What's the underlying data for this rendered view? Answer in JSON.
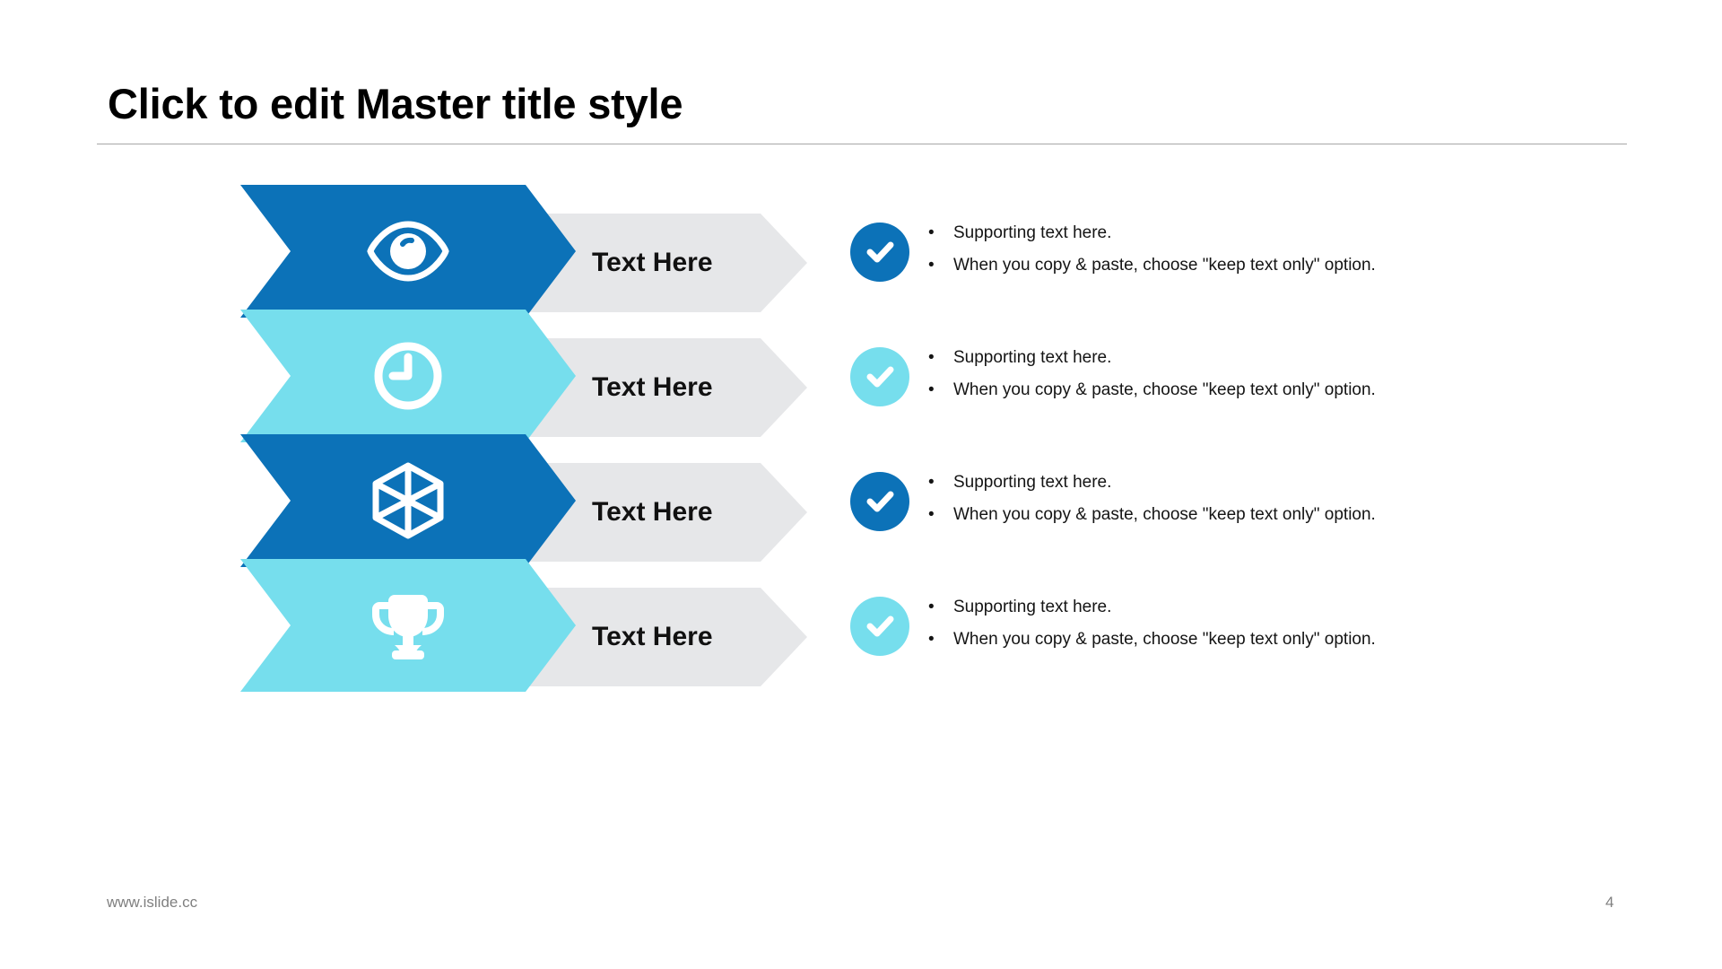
{
  "slide": {
    "title": "Click to edit Master title style",
    "footer_url": "www.islide.cc",
    "page_number": "4"
  },
  "colors": {
    "dark_blue": "#0C72B8",
    "light_blue": "#76DEED",
    "gray_chevron": "#E6E7E9",
    "title_rule": "#A6A6A6",
    "text": "#141414",
    "footer": "#7F7F7F"
  },
  "rows": [
    {
      "icon": "eye-icon",
      "color": "#0C72B8",
      "label": "Text Here",
      "badge": "check-circle-icon",
      "badge_color": "#0C72B8",
      "bullets": [
        "Supporting  text here.",
        "When  you copy & paste, choose \"keep text only\" option."
      ]
    },
    {
      "icon": "clock-icon",
      "color": "#76DEED",
      "label": "Text Here",
      "badge": "check-circle-icon",
      "badge_color": "#76DEED",
      "bullets": [
        "Supporting  text here.",
        "When  you copy & paste, choose \"keep text only\" option."
      ]
    },
    {
      "icon": "cube-icon",
      "color": "#0C72B8",
      "label": "Text Here",
      "badge": "check-circle-icon",
      "badge_color": "#0C72B8",
      "bullets": [
        "Supporting  text here.",
        "When  you copy & paste, choose \"keep text only\" option."
      ]
    },
    {
      "icon": "trophy-icon",
      "color": "#76DEED",
      "label": "Text Here",
      "badge": "check-circle-icon",
      "badge_color": "#76DEED",
      "bullets": [
        "Supporting  text here.",
        "When  you copy & paste, choose \"keep text only\" option."
      ]
    }
  ],
  "bullet_marker": "•"
}
